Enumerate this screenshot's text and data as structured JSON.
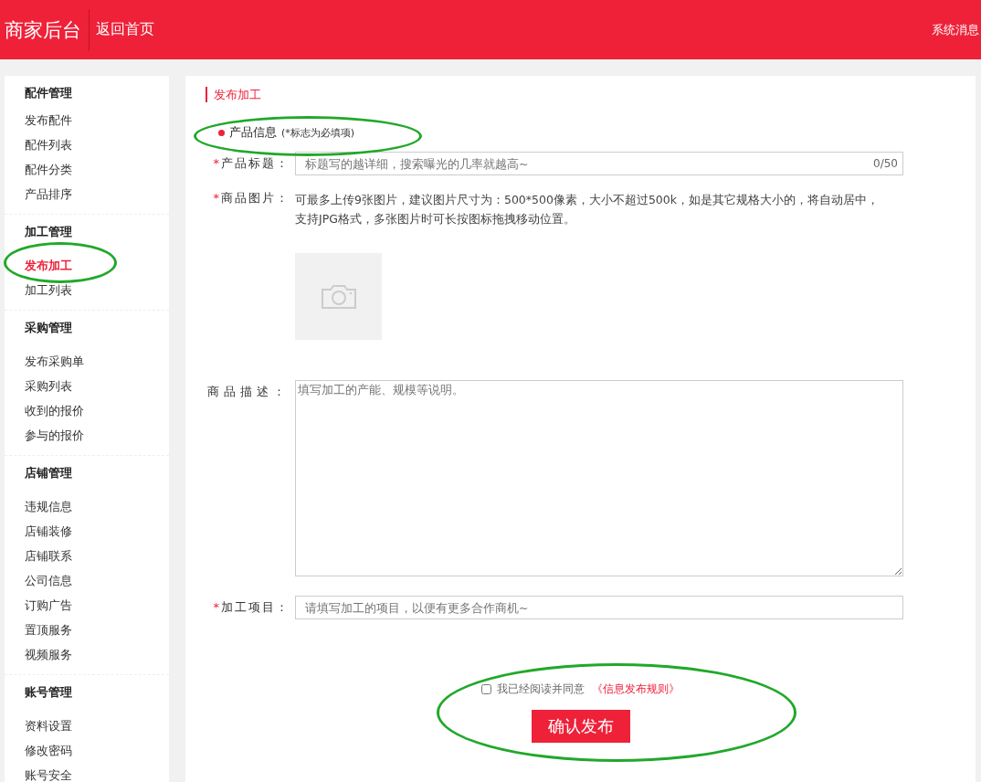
{
  "header": {
    "title": "商家后台",
    "back_link": "返回首页",
    "messages": "系统消息"
  },
  "sidebar": {
    "sections": [
      {
        "heading": "配件管理",
        "items": [
          {
            "label": "发布配件",
            "selected": false
          },
          {
            "label": "配件列表",
            "selected": false
          },
          {
            "label": "配件分类",
            "selected": false
          },
          {
            "label": "产品排序",
            "selected": false
          }
        ]
      },
      {
        "heading": "加工管理",
        "items": [
          {
            "label": "发布加工",
            "selected": true
          },
          {
            "label": "加工列表",
            "selected": false
          }
        ]
      },
      {
        "heading": "采购管理",
        "items": [
          {
            "label": "发布采购单",
            "selected": false
          },
          {
            "label": "采购列表",
            "selected": false
          },
          {
            "label": "收到的报价",
            "selected": false
          },
          {
            "label": "参与的报价",
            "selected": false
          }
        ]
      },
      {
        "heading": "店铺管理",
        "items": [
          {
            "label": "违规信息",
            "selected": false
          },
          {
            "label": "店铺装修",
            "selected": false
          },
          {
            "label": "店铺联系",
            "selected": false
          },
          {
            "label": "公司信息",
            "selected": false
          },
          {
            "label": "订购广告",
            "selected": false
          },
          {
            "label": "置顶服务",
            "selected": false
          },
          {
            "label": "视频服务",
            "selected": false
          }
        ]
      },
      {
        "heading": "账号管理",
        "items": [
          {
            "label": "资料设置",
            "selected": false
          },
          {
            "label": "修改密码",
            "selected": false
          },
          {
            "label": "账号安全",
            "selected": false
          }
        ]
      }
    ]
  },
  "main": {
    "title": "发布加工",
    "section": {
      "label": "产品信息",
      "note": "(*标志为必填项)"
    },
    "fields": [
      {
        "kind": "input",
        "mark": "*",
        "label": "产品标题：",
        "placeholder": "标题写的越详细，搜索曝光的几率就越高~",
        "counter": "0/50"
      },
      {
        "kind": "upload",
        "mark": "*",
        "label": "商品图片：",
        "hint": "可最多上传9张图片，建议图片尺寸为：500*500像素，大小不超过500k，如是其它规格大小的，将自动居中，支持JPG格式，多张图片时可长按图标拖拽移动位置。"
      },
      {
        "kind": "textarea",
        "label": "商品描述：",
        "placeholder": "填写加工的产能、规模等说明。"
      },
      {
        "kind": "input",
        "mark": "*",
        "label": "加工项目：",
        "placeholder": "请填写加工的项目，以便有更多合作商机~"
      }
    ],
    "agreement": {
      "checked": false,
      "text": "我已经阅读并同意",
      "link": "《信息发布规则》"
    },
    "submit": "确认发布"
  },
  "annotations": [
    {
      "kind": "ellipse"
    },
    {
      "kind": "ellipse"
    },
    {
      "kind": "ellipse"
    }
  ]
}
